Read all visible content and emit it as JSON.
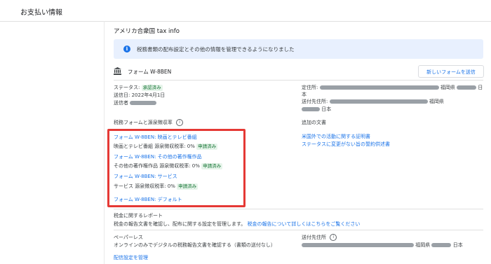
{
  "page": {
    "title": "お支払い情報"
  },
  "section": {
    "title": "アメリカ合衆国 tax info"
  },
  "banner": {
    "text": "税務書類の配布設定とその他の情報を管理できるようになりました"
  },
  "form": {
    "name": "フォーム W-8BEN",
    "new_form_button": "新しいフォームを送信",
    "status_label": "ステータス:",
    "status_badge": "承認済み",
    "sent_date": "送信日: 2022年4月1日",
    "sender_label": "送信者",
    "address_label": "定住所:",
    "address_region": "福岡県",
    "address_country_suffix": "日",
    "address_country_line2": "本",
    "mail_address_label": "送付先住所:",
    "mail_region": "福岡県",
    "mail_country": "日本"
  },
  "tax_forms": {
    "heading": "税務フォームと源泉徴収率",
    "items": [
      {
        "link": "フォーム W-8BEN: 映画とテレビ番組",
        "detail": "映画とテレビ番組 源泉徴収税率: 0%",
        "badge": "申請済み"
      },
      {
        "link": "フォーム W-8BEN: その他の著作権作品",
        "detail": "その他の著作権作品 源泉徴収税率: 0%",
        "badge": "申請済み"
      },
      {
        "link": "フォーム W-8BEN: サービス",
        "detail": "サービス 源泉徴収税率: 0%",
        "badge": "申請済み"
      },
      {
        "link": "フォーム W-8BEN: デフォルト",
        "detail": "",
        "badge": ""
      }
    ]
  },
  "additional_docs": {
    "heading": "追加の文書",
    "links": [
      "米国外での活動に関する証明書",
      "ステータスに変更がない旨の誓約供述書"
    ]
  },
  "tax_reports": {
    "heading": "税金に関するレポート",
    "text": "税金の報告文書を確認し、配布に関する設定を管理します。",
    "link": "税金の報告について詳しくはこちらをご覧ください"
  },
  "paperless": {
    "heading": "ペーパーレス",
    "text": "オンラインのみでデジタルの税務報告文書を確認する（書類の送付なし）",
    "mail_label": "送付先住所",
    "region": "福岡県",
    "country": "日本",
    "settings_link": "配信設定を管理"
  },
  "colors": {
    "accent": "#1a73e8",
    "highlight_box": "#e53935",
    "badge_bg": "#e6f4ea",
    "badge_text": "#137333",
    "banner_bg": "#e8f0fe"
  },
  "icons": {
    "banner": "info-icon",
    "form": "bank-icon",
    "hint": "help-icon"
  }
}
